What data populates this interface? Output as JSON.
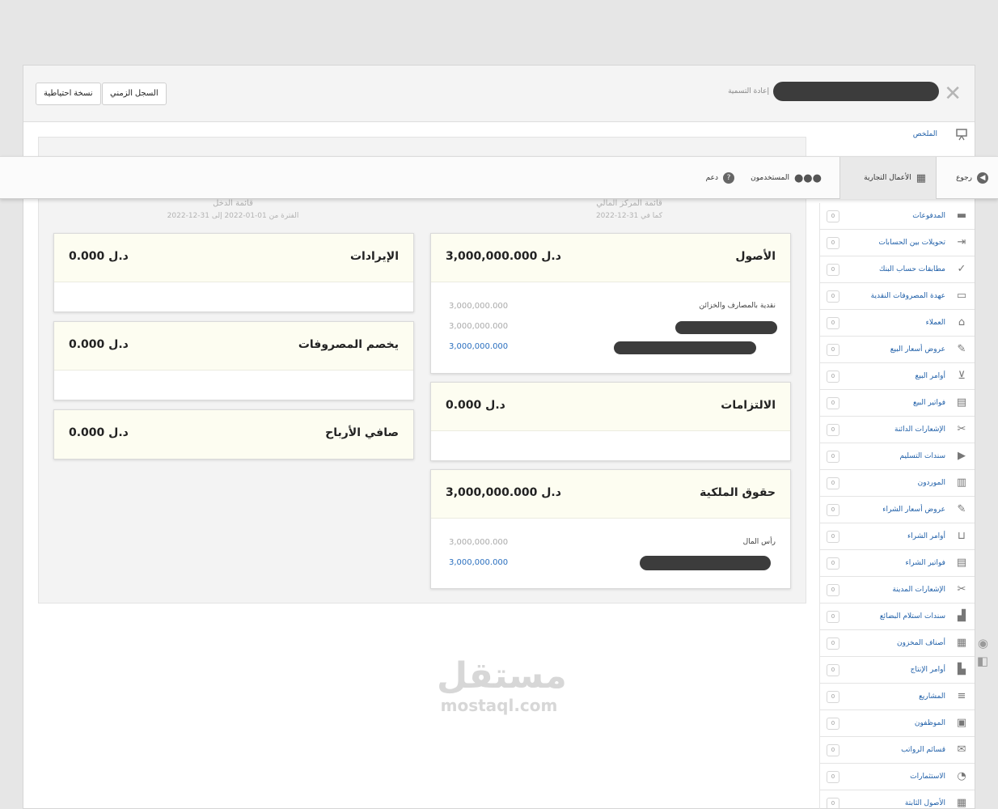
{
  "header": {
    "rename_label": "إعادة التسمية",
    "backup_button": "نسخة احتياطية",
    "log_button": "السجل الزمني",
    "close_glyph": "✕"
  },
  "topnav": {
    "back": "رجوع",
    "business": "الأعمال التجارية",
    "users": "المستخدمون",
    "support": "دعم"
  },
  "sidebar": {
    "summary": "الملخص",
    "items": [
      {
        "label": "المدفوعات",
        "count": "0",
        "icon": "payment-icon"
      },
      {
        "label": "تحويلات بين الحسابات",
        "count": "0",
        "icon": "transfer-icon"
      },
      {
        "label": "مطابقات حساب البنك",
        "count": "0",
        "icon": "clipboard-check-icon"
      },
      {
        "label": "عهدة المصروفات النقدية",
        "count": "0",
        "icon": "wallet-icon"
      },
      {
        "label": "العملاء",
        "count": "0",
        "icon": "customers-icon"
      },
      {
        "label": "عروض أسعار البيع",
        "count": "0",
        "icon": "quote-icon"
      },
      {
        "label": "أوامر البيع",
        "count": "0",
        "icon": "basket-icon"
      },
      {
        "label": "فواتير البيع",
        "count": "0",
        "icon": "invoice-icon"
      },
      {
        "label": "الإشعارات الدائنة",
        "count": "0",
        "icon": "scissors-icon"
      },
      {
        "label": "سندات التسليم",
        "count": "0",
        "icon": "truck-icon"
      },
      {
        "label": "الموردون",
        "count": "0",
        "icon": "factory-icon"
      },
      {
        "label": "عروض أسعار الشراء",
        "count": "0",
        "icon": "quote-icon"
      },
      {
        "label": "أوامر الشراء",
        "count": "0",
        "icon": "cart-icon"
      },
      {
        "label": "فواتير الشراء",
        "count": "0",
        "icon": "invoice-icon"
      },
      {
        "label": "الإشعارات المدينة",
        "count": "0",
        "icon": "scissors-icon"
      },
      {
        "label": "سندات استلام البضائع",
        "count": "0",
        "icon": "dolly-icon"
      },
      {
        "label": "أصناف المخزون",
        "count": "0",
        "icon": "inventory-icon"
      },
      {
        "label": "أوامر الإنتاج",
        "count": "0",
        "icon": "production-icon"
      },
      {
        "label": "المشاريع",
        "count": "0",
        "icon": "chart-bars-icon"
      },
      {
        "label": "الموظفون",
        "count": "0",
        "icon": "id-card-icon"
      },
      {
        "label": "قسائم الرواتب",
        "count": "0",
        "icon": "payslip-icon"
      },
      {
        "label": "الاستثمارات",
        "count": "0",
        "icon": "pie-icon"
      },
      {
        "label": "الأصول الثابتة",
        "count": "0",
        "icon": "building-icon"
      }
    ]
  },
  "balance_sheet": {
    "title": "قائمة المركز المالي",
    "date": "كما في 31-12-2022"
  },
  "income_statement": {
    "title": "قائمة الدخل",
    "period": "الفترة من 01-01-2022 إلى 31-12-2022"
  },
  "cards": {
    "assets": {
      "title": "الأصول",
      "value": "3,000,000.000 د.ل",
      "lines": [
        {
          "label": "نقدية بالمصارف والخزائن",
          "value": "3,000,000.000"
        },
        {
          "label": "",
          "value": "3,000,000.000"
        },
        {
          "label": "",
          "value": "3,000,000.000"
        }
      ]
    },
    "liabilities": {
      "title": "الالتزامات",
      "value": "0.000 د.ل"
    },
    "equity": {
      "title": "حقوق الملكية",
      "value": "3,000,000.000 د.ل",
      "lines": [
        {
          "label": "رأس المال",
          "value": "3,000,000.000"
        },
        {
          "label": "",
          "value": "3,000,000.000"
        }
      ]
    },
    "revenue": {
      "title": "الإيرادات",
      "value": "0.000 د.ل"
    },
    "expenses": {
      "title": "يخصم المصروفات",
      "value": "0.000 د.ل"
    },
    "net_profit": {
      "title": "صافي الأرباح",
      "value": "0.000 د.ل"
    }
  },
  "watermark": {
    "arabic": "مستقل",
    "latin": "mostaql.com"
  }
}
